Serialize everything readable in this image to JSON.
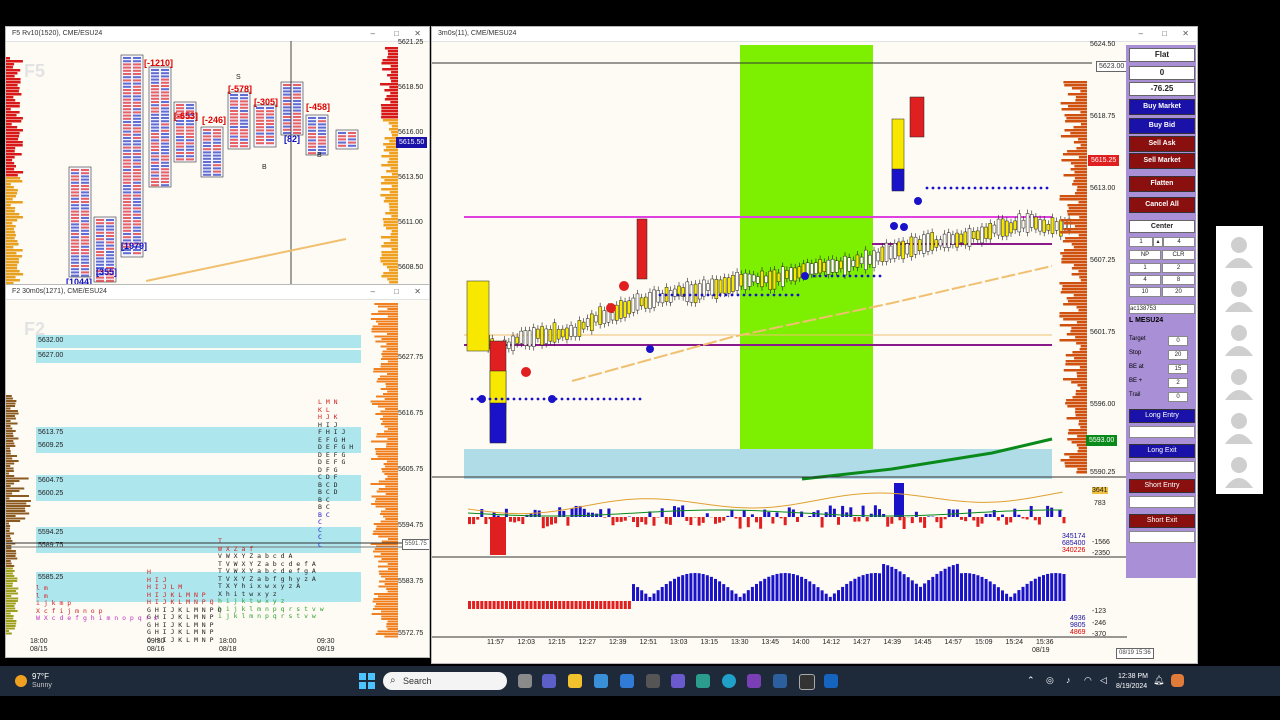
{
  "windows": {
    "topleft": {
      "title": "F5 Rv10(1520), CME/ESU24",
      "watermark": "F5",
      "prices": [
        "5621.25",
        "5618.50",
        "5616.00",
        "5613.50",
        "5611.00",
        "5608.50"
      ],
      "current_price": "5615.50",
      "labels": [
        "[-1210]",
        "[-653]",
        "[-246]",
        "[-578]",
        "[-305]",
        "[-458]",
        "[1979]",
        "[355]",
        "[1044]",
        "[82]"
      ],
      "letters": [
        "S",
        "S",
        "S",
        "S",
        "B",
        "B",
        "B"
      ]
    },
    "bottomleft": {
      "title": "F2 30m0s(1271), CME/ESU24",
      "watermark": "F2",
      "prices": [
        "5627.75",
        "5616.75",
        "5605.75",
        "5594.75",
        "5583.75",
        "5572.75"
      ],
      "current_price": "5591.75",
      "levels": [
        "5632.00",
        "5627.00",
        "5613.75",
        "5609.25",
        "5604.75",
        "5600.25",
        "5594.25",
        "5589.75",
        "5585.25"
      ],
      "time_labels": [
        [
          "18:00",
          "08/15"
        ],
        [
          "09:30",
          "08/16"
        ],
        [
          "18:00",
          "08/18"
        ],
        [
          "09:30",
          "08/19"
        ]
      ],
      "profile_rows": [
        "L M N",
        "K L",
        "H J K",
        "H I J",
        "F H I J",
        "E F G H",
        "D E F G H",
        "D E F G",
        "D E F G",
        "D F G",
        "C D F",
        "B C D",
        "B C D",
        "B C",
        "B C",
        "B C",
        "C",
        "C",
        "C",
        "C"
      ],
      "profile_rows_b": [
        "T",
        "W X Z a f",
        "V W X Y Z a b c d A",
        "T V W X Y Z a b c d e f A",
        "T V W X Y a b c d e f g A",
        "T V X Y Z a b f g h y z A",
        "T X Y h i x w x y z A",
        "X h i t w x y z",
        "h i j k t w x y z",
        "h i j k l m n p q r s t v w",
        "i j k l m n p q r s t v w"
      ],
      "profile_rows_c": [
        "H",
        "H I J",
        "H I J L M",
        "H I J K L M N P",
        "H I J K L M N P Q",
        "G H I J K L M N P Q",
        "G H I J K L M N P",
        "G H I J K L M N P",
        "G H I J K L M N P",
        "G H I J K L M N P"
      ],
      "profile_rows_d": [
        "l m",
        "l m",
        "i j k m p",
        "X c f i j m n o p",
        "W X c d e f g h i m n o p q r s"
      ]
    },
    "main": {
      "title": "3m0s(11), CME/MESU24",
      "prices": [
        "5624.50",
        "5618.75",
        "5613.00",
        "5607.25",
        "5601.75",
        "5596.00",
        "5590.25"
      ],
      "boxed_prices": {
        "top": "5623.00",
        "current": "5615.25",
        "bottom": "5593.00"
      },
      "times": [
        "11:57",
        "12:03",
        "12:15",
        "12:27",
        "12:39",
        "12:51",
        "13:03",
        "13:15",
        "13:30",
        "13:45",
        "14:00",
        "14:12",
        "14:27",
        "14:39",
        "14:45",
        "14:57",
        "15:09",
        "15:24",
        "15:36"
      ],
      "date_label": "08/19",
      "date_box": "08/19 15:36",
      "indicator1": [
        "3641",
        "783",
        "-1566",
        "-2350",
        "345174",
        "685400",
        "340226"
      ],
      "indicator2": [
        "4936",
        "9805",
        "4869",
        "-123",
        "-246",
        "-370"
      ]
    }
  },
  "order_panel": {
    "position": "Flat",
    "quantity": "0",
    "pnl": "-76.25",
    "buy_market": "Buy Market",
    "buy_bid": "Buy Bid",
    "sell_ask": "Sell Ask",
    "sell_market": "Sell Market",
    "flatten": "Flatten",
    "cancel_all": "Cancel All",
    "center": "Center",
    "qty_value": "1",
    "qty_display": "4",
    "grid": [
      [
        "NP",
        "CLR"
      ],
      [
        "1",
        "2"
      ],
      [
        "4",
        "8"
      ],
      [
        "10",
        "20"
      ]
    ],
    "account": "ac138753",
    "symbol": "L MESU24",
    "target_label": "Target",
    "target": "0",
    "stop_label": "Stop",
    "stop": "20",
    "be_at_label": "BE at",
    "be_at": "15",
    "be_plus_label": "BE +",
    "be_plus": "2",
    "trail_label": "Trail",
    "trail": "0",
    "long_entry": "Long Entry",
    "long_exit": "Long Exit",
    "short_entry": "Short Entry",
    "short_exit": "Short Exit"
  },
  "taskbar": {
    "weather_temp": "97°F",
    "weather_desc": "Sunny",
    "search_placeholder": "Search",
    "time": "12:38 PM",
    "date": "8/19/2024"
  }
}
